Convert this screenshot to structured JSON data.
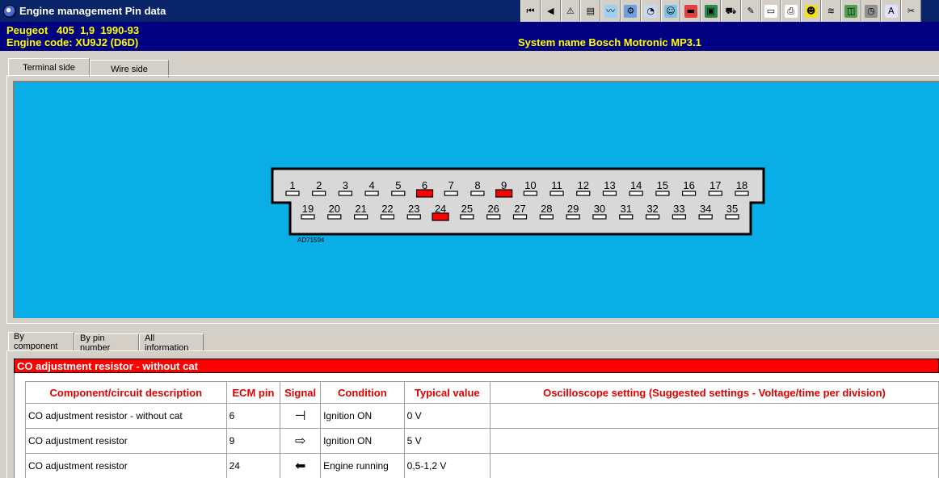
{
  "window": {
    "title": "Engine management Pin data",
    "toolbar_icons": [
      "first-icon",
      "back-icon",
      "warning-icon",
      "document-icon",
      "scope-icon",
      "gear-icon",
      "gauge-icon",
      "people-icon",
      "fuel-icon",
      "save-icon",
      "car-icon",
      "tool-icon",
      "computer-icon",
      "print-icon",
      "face-icon",
      "wiring-icon",
      "diagram-icon",
      "clock-icon",
      "font-icon",
      "tools-icon"
    ]
  },
  "vehicle": {
    "make": "Peugeot",
    "model": "405",
    "engine_size": "1,9",
    "years": "1990-93",
    "engine_code": "Engine code: XU9J2 (D6D)",
    "system_name": "System name Bosch Motronic MP3.1"
  },
  "connector_tabs": [
    "Terminal side",
    "Wire side"
  ],
  "connector": {
    "label": "AD71594",
    "top_row": [
      "1",
      "2",
      "3",
      "4",
      "5",
      "6",
      "7",
      "8",
      "9",
      "10",
      "11",
      "12",
      "13",
      "14",
      "15",
      "16",
      "17",
      "18"
    ],
    "bottom_row": [
      "19",
      "20",
      "21",
      "22",
      "23",
      "24",
      "25",
      "26",
      "27",
      "28",
      "29",
      "30",
      "31",
      "32",
      "33",
      "34",
      "35"
    ],
    "highlighted": [
      "6",
      "9",
      "24"
    ],
    "highlight_color": "#ff0000"
  },
  "info_tabs": [
    "By component",
    "By pin number",
    "All information"
  ],
  "section_title": "CO adjustment resistor - without cat",
  "table": {
    "headers": [
      "Component/circuit description",
      "ECM pin",
      "Signal",
      "Condition",
      "Typical value",
      "Oscilloscope setting (Suggested settings - Voltage/time per division)"
    ],
    "rows": [
      {
        "description": "CO adjustment resistor - without cat",
        "pin": "6",
        "signal_icon": "ground-signal-icon",
        "signal_glyph": "⊣",
        "condition": "Ignition ON",
        "value": "0 V",
        "scope": ""
      },
      {
        "description": "CO adjustment resistor",
        "pin": "9",
        "signal_icon": "output-arrow-icon",
        "signal_glyph": "⇨",
        "condition": "Ignition ON",
        "value": "5 V",
        "scope": ""
      },
      {
        "description": "CO adjustment resistor",
        "pin": "24",
        "signal_icon": "input-arrow-icon",
        "signal_glyph": "⬅",
        "condition": "Engine running",
        "value": "0,5-1,2 V",
        "scope": ""
      }
    ]
  }
}
